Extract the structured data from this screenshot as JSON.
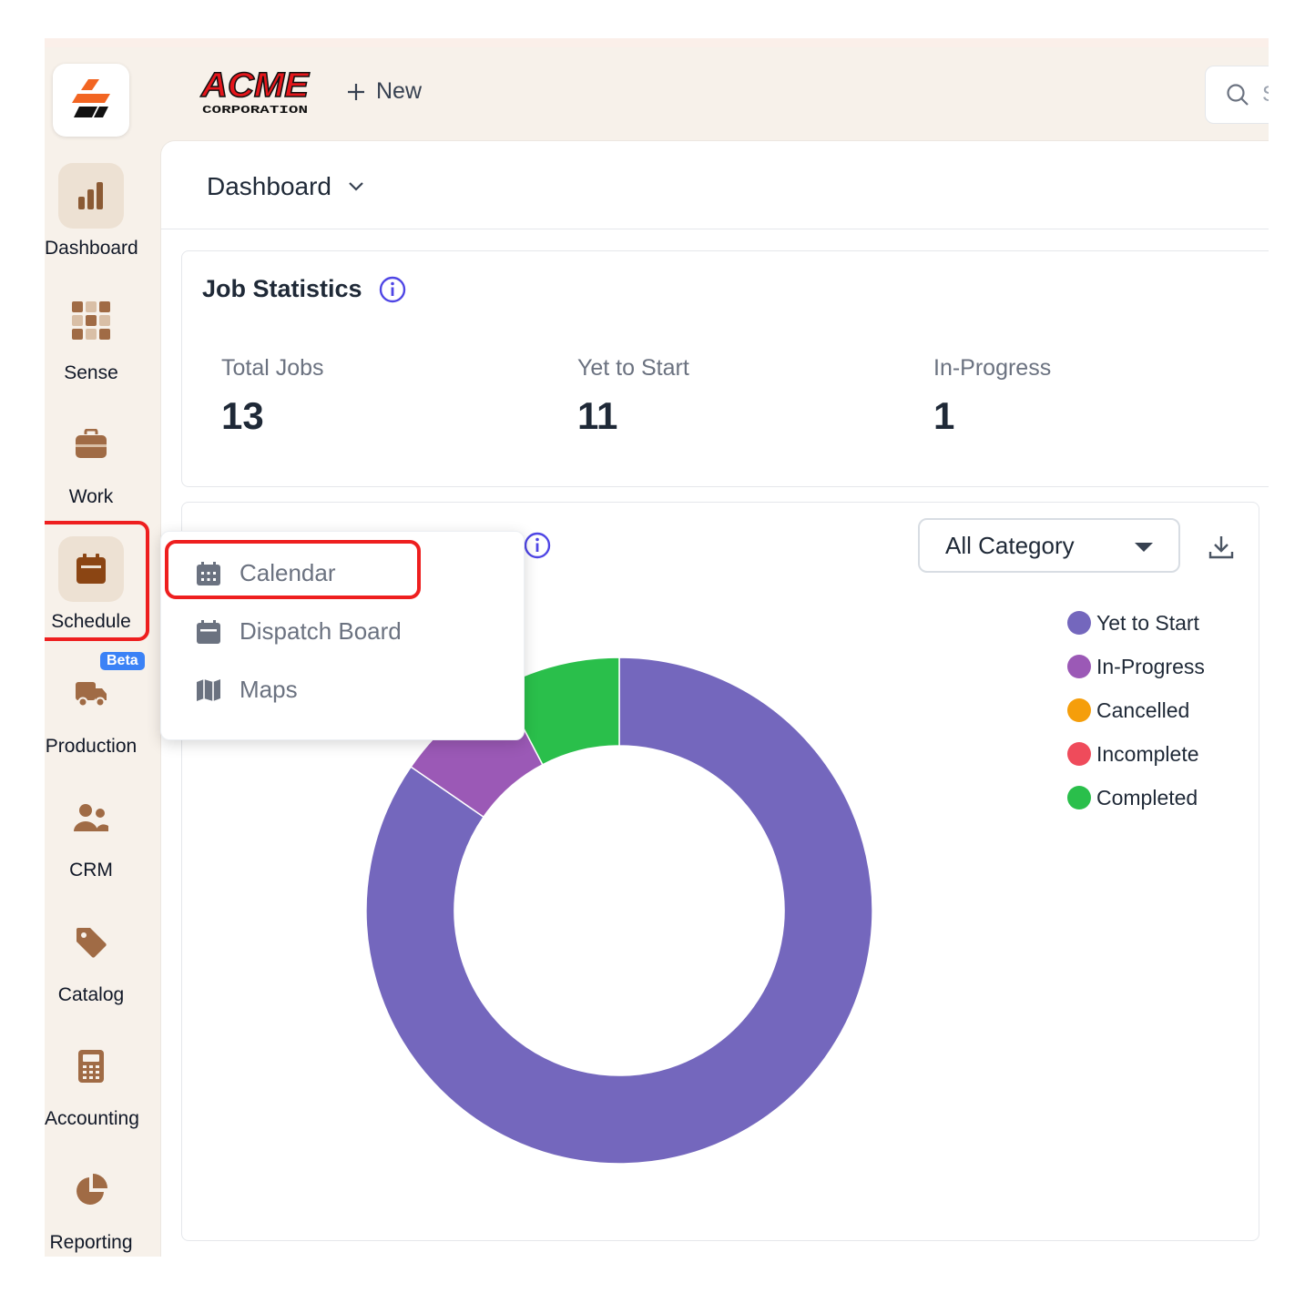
{
  "sidebar": {
    "items": [
      {
        "label": "Dashboard",
        "icon": "bar-chart-icon"
      },
      {
        "label": "Sense",
        "icon": "grid-icon"
      },
      {
        "label": "Work",
        "icon": "briefcase-icon"
      },
      {
        "label": "Schedule",
        "icon": "calendar-icon"
      },
      {
        "label": "Production",
        "icon": "truck-icon",
        "badge": "Beta"
      },
      {
        "label": "CRM",
        "icon": "users-icon"
      },
      {
        "label": "Catalog",
        "icon": "tag-icon"
      },
      {
        "label": "Accounting",
        "icon": "calculator-icon"
      },
      {
        "label": "Reporting",
        "icon": "pie-chart-icon"
      }
    ]
  },
  "header": {
    "brand": "ACME",
    "brand_sub": "CORPORATION",
    "new_label": "New",
    "new_icon": "plus-icon",
    "search_placeholder": "S",
    "search_icon": "search-icon"
  },
  "main": {
    "title": "Dashboard",
    "job_statistics": {
      "title": "Job Statistics",
      "stats": [
        {
          "label": "Total Jobs",
          "value": "13"
        },
        {
          "label": "Yet to Start",
          "value": "11"
        },
        {
          "label": "In-Progress",
          "value": "1"
        }
      ]
    },
    "status_chart": {
      "category_select": "All Category",
      "download_icon": "download-icon"
    }
  },
  "schedule_menu": {
    "items": [
      {
        "label": "Calendar",
        "icon": "calendar-grid-icon"
      },
      {
        "label": "Dispatch Board",
        "icon": "calendar-icon"
      },
      {
        "label": "Maps",
        "icon": "map-icon"
      }
    ]
  },
  "colors": {
    "accent": "#8b5a34",
    "sidebar_bg": "#f7f1ea",
    "info": "#4f46e5",
    "highlight": "#ee1f1f"
  },
  "chart_data": {
    "type": "pie",
    "variant": "donut",
    "categories": [
      "Yet to Start",
      "In-Progress",
      "Cancelled",
      "Incomplete",
      "Completed"
    ],
    "values": [
      11,
      1,
      0,
      0,
      1
    ],
    "colors": [
      "#7467bd",
      "#9b59b6",
      "#f59e0b",
      "#ef4b5b",
      "#2abf4b"
    ],
    "legend": "right"
  }
}
